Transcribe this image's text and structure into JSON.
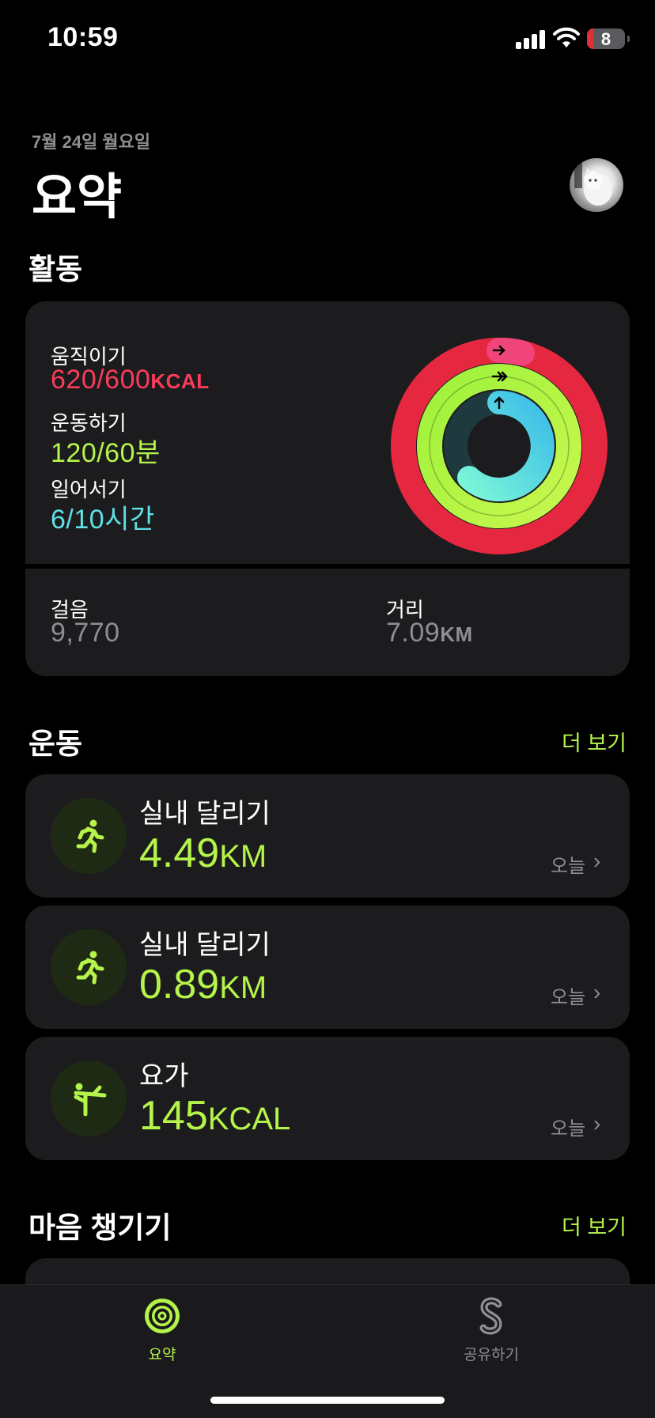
{
  "status": {
    "time": "10:59",
    "battery": "8"
  },
  "header": {
    "date": "7월 24일 월요일",
    "title": "요약"
  },
  "activity": {
    "heading": "활동",
    "move": {
      "label": "움직이기",
      "value": "620/600",
      "unit": "KCAL",
      "progress": 1.03,
      "color": "#fa2d55"
    },
    "exercise": {
      "label": "운동하기",
      "value": "120/60",
      "unit": "분",
      "progress": 2.0,
      "color": "#b5f44a"
    },
    "stand": {
      "label": "일어서기",
      "value": "6/10",
      "unit": "시간",
      "progress": 0.6,
      "color": "#5ee0e6"
    },
    "steps": {
      "label": "걸음",
      "value": "9,770"
    },
    "distance": {
      "label": "거리",
      "value": "7.09",
      "unit": "KM"
    }
  },
  "workouts": {
    "heading": "운동",
    "more": "더 보기",
    "items": [
      {
        "name": "실내 달리기",
        "value": "4.49",
        "unit": "KM",
        "when": "오늘",
        "icon": "running-icon"
      },
      {
        "name": "실내 달리기",
        "value": "0.89",
        "unit": "KM",
        "when": "오늘",
        "icon": "running-icon"
      },
      {
        "name": "요가",
        "value": "145",
        "unit": "KCAL",
        "when": "오늘",
        "icon": "yoga-icon"
      }
    ]
  },
  "mindfulness": {
    "heading": "마음 챙기기",
    "more": "더 보기"
  },
  "tabbar": {
    "tabs": [
      {
        "label": "요약",
        "active": true,
        "icon": "activity-rings-icon"
      },
      {
        "label": "공유하기",
        "active": false,
        "icon": "sharing-icon"
      }
    ]
  }
}
